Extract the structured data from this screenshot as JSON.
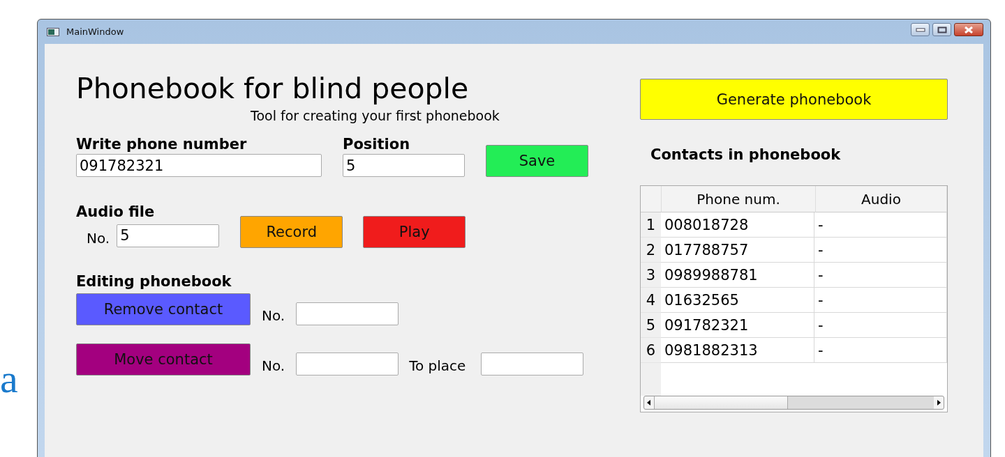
{
  "background_text": "a",
  "window": {
    "title": "MainWindow"
  },
  "heading": "Phonebook for blind people",
  "subtitle": "Tool for creating your first phonebook",
  "phone": {
    "label": "Write phone number",
    "value": "091782321"
  },
  "position": {
    "label": "Position",
    "value": "5"
  },
  "save_button": "Save",
  "audio": {
    "label": "Audio file",
    "no_label": "No.",
    "no_value": "5",
    "record_button": "Record",
    "play_button": "Play"
  },
  "editing": {
    "label": "Editing phonebook",
    "remove_button": "Remove contact",
    "remove_no_label": "No.",
    "move_button": "Move contact",
    "move_no_label": "No.",
    "to_place_label": "To place"
  },
  "generate_button": "Generate phonebook",
  "contacts": {
    "title": "Contacts in phonebook",
    "columns": [
      "Phone num.",
      "Audio"
    ],
    "rows": [
      {
        "index": "1",
        "phone": "008018728",
        "audio": "-"
      },
      {
        "index": "2",
        "phone": "017788757",
        "audio": "-"
      },
      {
        "index": "3",
        "phone": "0989988781",
        "audio": "-"
      },
      {
        "index": "4",
        "phone": "01632565",
        "audio": "-"
      },
      {
        "index": "5",
        "phone": "091782321",
        "audio": "-"
      },
      {
        "index": "6",
        "phone": "0981882313",
        "audio": "-"
      }
    ]
  }
}
